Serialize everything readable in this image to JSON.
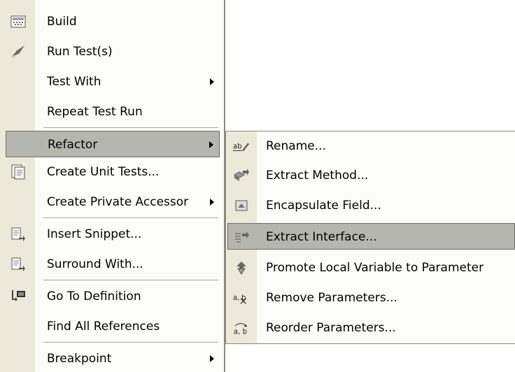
{
  "main_menu": {
    "items": [
      {
        "label": "Build",
        "icon": "build-icon"
      },
      {
        "label": "Run Test(s)",
        "icon": "rocket-icon"
      },
      {
        "label": "Test With",
        "submenu": true
      },
      {
        "label": "Repeat Test Run"
      },
      {
        "label": "Refactor",
        "submenu": true,
        "highlighted": true
      },
      {
        "label": "Create Unit Tests...",
        "icon": "unit-test-icon"
      },
      {
        "label": "Create Private Accessor",
        "submenu": true
      },
      {
        "label": "Insert Snippet...",
        "icon": "insert-snippet-icon"
      },
      {
        "label": "Surround With...",
        "icon": "surround-with-icon"
      },
      {
        "label": "Go To Definition",
        "icon": "go-to-definition-icon"
      },
      {
        "label": "Find All References"
      },
      {
        "label": "Breakpoint",
        "submenu": true
      }
    ]
  },
  "refactor_menu": {
    "items": [
      {
        "label": "Rename...",
        "icon": "rename-icon"
      },
      {
        "label": "Extract Method...",
        "icon": "extract-method-icon"
      },
      {
        "label": "Encapsulate Field...",
        "icon": "encapsulate-field-icon"
      },
      {
        "label": "Extract Interface...",
        "icon": "extract-interface-icon",
        "highlighted": true
      },
      {
        "label": "Promote Local Variable to Parameter",
        "icon": "promote-variable-icon"
      },
      {
        "label": "Remove Parameters...",
        "icon": "remove-parameters-icon"
      },
      {
        "label": "Reorder Parameters...",
        "icon": "reorder-parameters-icon"
      }
    ]
  },
  "colors": {
    "menu_background": "#fcfcf9",
    "gutter": "#ece9d8",
    "highlight": "#b6b6b0",
    "highlight_border": "#6e6e68"
  }
}
